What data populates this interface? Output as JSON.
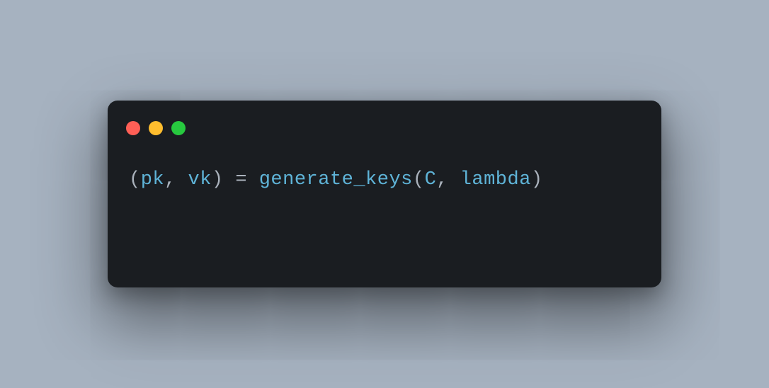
{
  "window": {
    "traffic_lights": {
      "red": "close",
      "yellow": "minimize",
      "green": "zoom"
    }
  },
  "code": {
    "tokens": [
      {
        "t": "(",
        "cls": "tok-punct"
      },
      {
        "t": "pk",
        "cls": "tok-ident"
      },
      {
        "t": ", ",
        "cls": "tok-punct"
      },
      {
        "t": "vk",
        "cls": "tok-ident"
      },
      {
        "t": ") ",
        "cls": "tok-punct"
      },
      {
        "t": "= ",
        "cls": "tok-punct"
      },
      {
        "t": "generate_keys",
        "cls": "tok-func"
      },
      {
        "t": "(",
        "cls": "tok-punct"
      },
      {
        "t": "C",
        "cls": "tok-ident"
      },
      {
        "t": ", ",
        "cls": "tok-punct"
      },
      {
        "t": "lambda",
        "cls": "tok-kw"
      },
      {
        "t": ")",
        "cls": "tok-punct"
      }
    ]
  }
}
